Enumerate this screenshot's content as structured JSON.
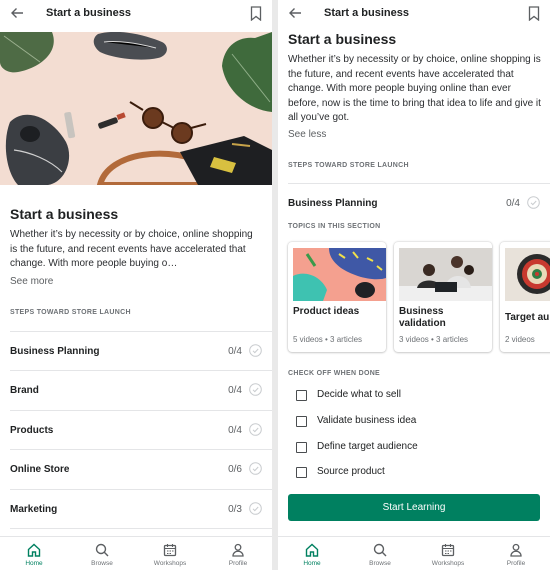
{
  "app": {
    "accent": "#008060"
  },
  "left": {
    "header_title": "Start a business",
    "heading": "Start a business",
    "description": "Whether it’s by necessity or by choice, online shopping is the future, and recent events have accelerated that change. With more people buying o…",
    "see_more": "See more",
    "steps_caption": "STEPS TOWARD STORE LAUNCH",
    "steps": [
      {
        "name": "Business Planning",
        "progress": "0/4"
      },
      {
        "name": "Brand",
        "progress": "0/4"
      },
      {
        "name": "Products",
        "progress": "0/4"
      },
      {
        "name": "Online Store",
        "progress": "0/6"
      },
      {
        "name": "Marketing",
        "progress": "0/3"
      }
    ]
  },
  "right": {
    "header_title": "Start a business",
    "heading": "Start a business",
    "description": "Whether it’s by necessity or by choice, online shopping is the future, and recent events have accelerated that change. With more people buying online than ever before, now is the time to bring that idea to life and give it all you’ve got.",
    "see_less": "See less",
    "steps_caption": "STEPS TOWARD STORE LAUNCH",
    "section_title": "Business Planning",
    "section_progress": "0/4",
    "topics_caption": "TOPICS IN THIS SECTION",
    "topics": [
      {
        "title": "Product ideas",
        "meta": "5 videos  •  3 articles"
      },
      {
        "title": "Business validation",
        "meta": "3 videos  •  3 articles"
      },
      {
        "title": "Target au",
        "meta": "2 videos"
      }
    ],
    "checkoff_caption": "CHECK OFF WHEN DONE",
    "checklist": [
      {
        "label": "Decide what to sell",
        "checked": false
      },
      {
        "label": "Validate business idea",
        "checked": false
      },
      {
        "label": "Define target audience",
        "checked": false
      },
      {
        "label": "Source product",
        "checked": false
      }
    ],
    "cta": "Start Learning"
  },
  "tabs": [
    {
      "label": "Home",
      "icon": "home-icon",
      "active": true
    },
    {
      "label": "Browse",
      "icon": "search-icon",
      "active": false
    },
    {
      "label": "Workshops",
      "icon": "calendar-icon",
      "active": false
    },
    {
      "label": "Profile",
      "icon": "profile-icon",
      "active": false
    }
  ]
}
